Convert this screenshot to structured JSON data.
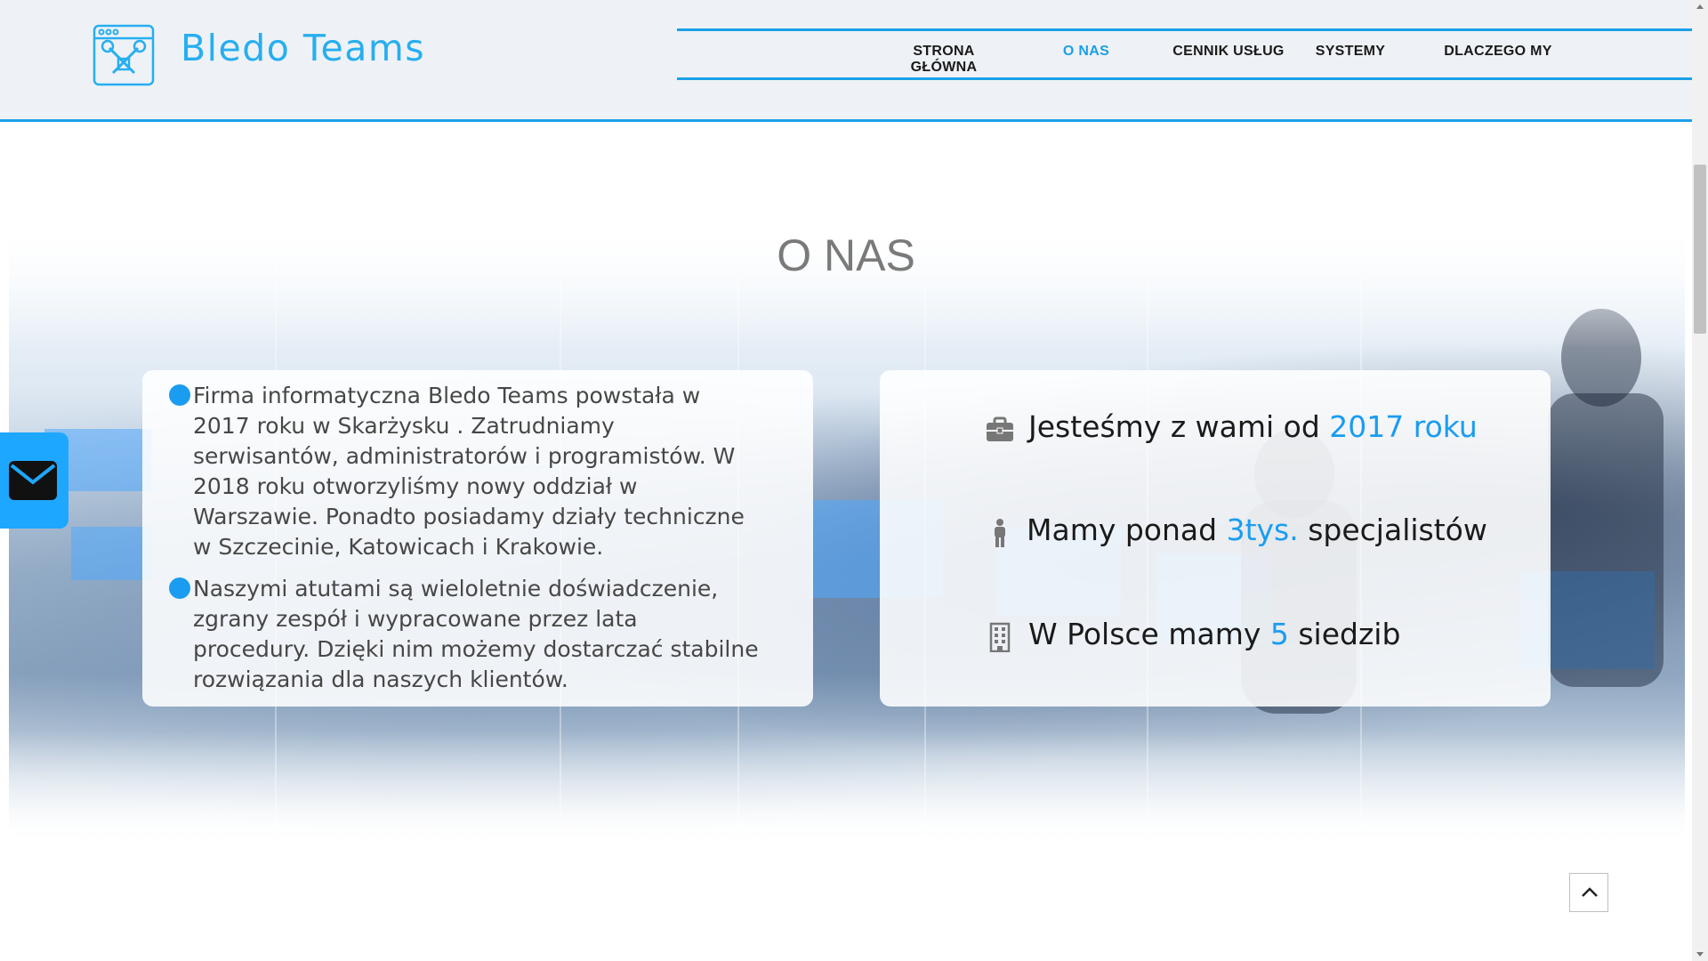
{
  "brand": {
    "name": "Bledo Teams",
    "logo_icon": "tools-window-icon"
  },
  "nav": {
    "items": [
      {
        "label": "STRONA\nGŁÓWNA",
        "line1": "STRONA",
        "line2": "GŁÓWNA",
        "active": false
      },
      {
        "label": "O NAS",
        "active": true
      },
      {
        "label": "CENNIK USŁUG",
        "active": false
      },
      {
        "label": "SYSTEMY",
        "active": false
      },
      {
        "label": "DLACZEGO MY",
        "active": false
      }
    ]
  },
  "section": {
    "title": "O NAS",
    "paragraphs": [
      "Firma informatyczna Bledo Teams powstała w 2017 roku w Skarżysku . Zatrudniamy serwisantów, administratorów i programistów. W 2018 roku otworzyliśmy nowy oddział w Warszawie. Ponadto posiadamy działy techniczne w Szczecinie, Katowicach i Krakowie.",
      "Naszymi atutami są wieloletnie doświadczenie, zgrany zespół i wypracowane przez lata procedury. Dzięki nim możemy dostarczać stabilne rozwiązania dla naszych klientów."
    ],
    "paragraph_lines": [
      [
        "Firma informatyczna Bledo Teams powstała w",
        "2017 roku w Skarżysku . Zatrudniamy",
        "serwisantów, administratorów i programistów. W",
        "2018 roku otworzyliśmy nowy oddział w",
        "Warszawie. Ponadto posiadamy działy techniczne",
        "w Szczecinie, Katowicach i Krakowie."
      ],
      [
        "Naszymi atutami są wieloletnie doświadczenie,",
        "zgrany zespół i wypracowane przez lata",
        "procedury. Dzięki nim możemy dostarczać stabilne",
        "rozwiązania dla naszych klientów."
      ]
    ],
    "stats": [
      {
        "icon": "briefcase-icon",
        "before": "Jesteśmy z wami od ",
        "highlight": "2017 roku",
        "after": ""
      },
      {
        "icon": "person-icon",
        "before": "Mamy ponad ",
        "highlight": "3tys.",
        "after": " specjalistów"
      },
      {
        "icon": "building-icon",
        "before": "W Polsce mamy ",
        "highlight": "5",
        "after": " siedzib"
      }
    ]
  },
  "floating": {
    "mail_icon": "envelope-icon",
    "to_top_icon": "chevron-up-icon"
  },
  "colors": {
    "accent": "#1a9cf0",
    "nav_border": "#1aa0e8",
    "brand": "#27aef0",
    "header_bg": "#eef2f6",
    "mail_tab": "#1ea7ff"
  }
}
